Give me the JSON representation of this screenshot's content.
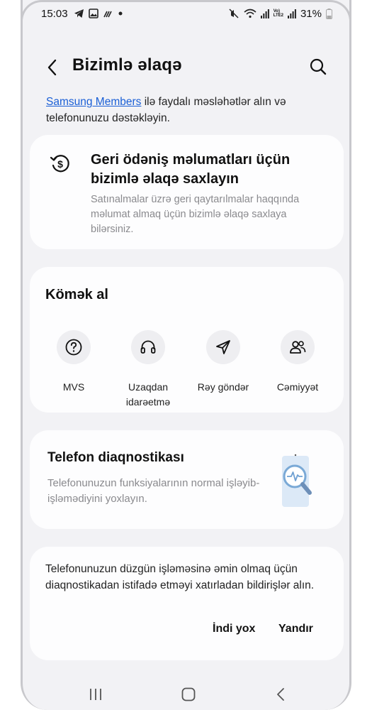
{
  "status_bar": {
    "time": "15:03",
    "volte": "Vo)\nLTE2",
    "battery": "31%"
  },
  "header": {
    "title": "Bizimlə əlaqə"
  },
  "intro": {
    "link": "Samsung Members",
    "text": " ilə faydalı məsləhətlər alın və telefonunuzu dəstəkləyin."
  },
  "refund_card": {
    "title": "Geri ödəniş məlumatları üçün bizimlə əlaqə saxlayın",
    "description": "Satınalmalar üzrə geri qaytarılmalar haqqında məlumat almaq üçün bizimlə əlaqə saxlaya bilərsiniz."
  },
  "help_card": {
    "title": "Kömək al",
    "items": [
      {
        "label": "MVS",
        "icon": "question-icon"
      },
      {
        "label": "Uzaqdan idarəetmə",
        "icon": "headset-icon"
      },
      {
        "label": "Rəy göndər",
        "icon": "send-icon"
      },
      {
        "label": "Cəmiyyət",
        "icon": "community-icon"
      }
    ]
  },
  "diagnostics_card": {
    "title": "Telefon diaqnostikası",
    "description": "Telefonunuzun funksiyalarının normal işləyib-işləmədiyini yoxlayın."
  },
  "notice_card": {
    "text": "Telefonunuzun düzgün işləməsinə əmin olmaq üçün diaqnostikadan istifadə etməyi xatırladan bildirişlər alın.",
    "later_label": "İndi yox",
    "enable_label": "Yandır"
  },
  "colors": {
    "link": "#1a5fd6",
    "background": "#f2f2f5",
    "card": "#fdfdfe",
    "secondary_text": "#8a8a8e"
  }
}
